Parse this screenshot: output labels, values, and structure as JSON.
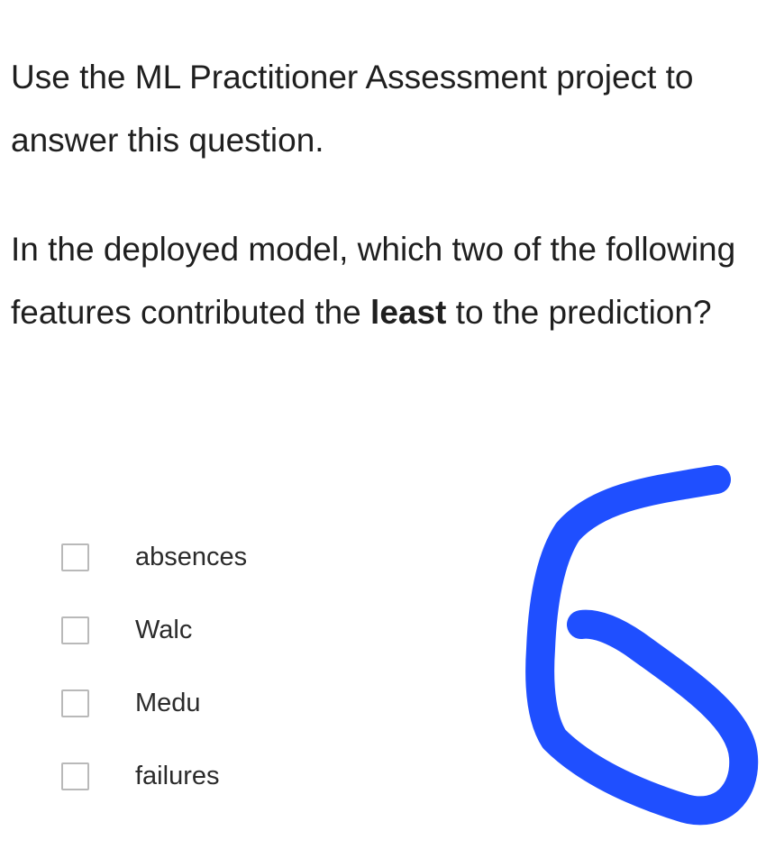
{
  "intro_text": "Use the ML Practitioner Assessment project to answer this question.",
  "question": {
    "before_bold": "In the deployed model, which two of the following features contributed the ",
    "bold": "least",
    "after_bold": " to the prediction?"
  },
  "options": [
    {
      "label": "absences",
      "checked": false
    },
    {
      "label": "Walc",
      "checked": false
    },
    {
      "label": "Medu",
      "checked": false
    },
    {
      "label": "failures",
      "checked": false
    }
  ],
  "annotation": {
    "color": "#1f4fff"
  }
}
